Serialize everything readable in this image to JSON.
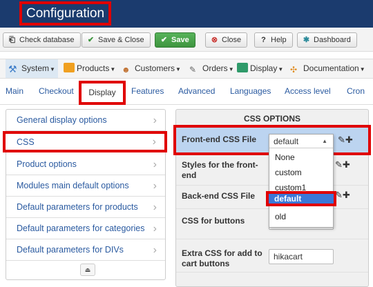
{
  "header": {
    "title": "Configuration"
  },
  "toolbar": {
    "check_database": "Check database",
    "save_close": "Save & Close",
    "save": "Save",
    "close": "Close",
    "help": "Help",
    "dashboard": "Dashboard"
  },
  "menu": {
    "system": "System",
    "products": "Products",
    "customers": "Customers",
    "orders": "Orders",
    "display": "Display",
    "documentation": "Documentation"
  },
  "tabs": [
    "Main",
    "Checkout",
    "Display",
    "Features",
    "Advanced",
    "Languages",
    "Access level",
    "Cron"
  ],
  "sidebar": {
    "items": [
      "General display options",
      "CSS",
      "Product options",
      "Modules main default options",
      "Default parameters for products",
      "Default parameters for categories",
      "Default parameters for DIVs"
    ]
  },
  "panel": {
    "title": "CSS OPTIONS",
    "frontend_label": "Front-end CSS File",
    "styles_label": "Styles for the front-end",
    "backend_label": "Back-end CSS File",
    "buttons_label": "CSS for buttons",
    "extra_label": "Extra CSS for add to cart buttons",
    "extra_value": "hikacart"
  },
  "dropdown": {
    "selected": "default",
    "options": [
      "None",
      "custom",
      "custom1",
      "default",
      "old"
    ],
    "highlighted_index": 3
  },
  "colors": {
    "header_bg": "#1b3b6e",
    "annotation": "#e00000",
    "row_highlight": "#bcd4f0",
    "option_highlight": "#3b78d8",
    "save_green": "#3e953f"
  }
}
